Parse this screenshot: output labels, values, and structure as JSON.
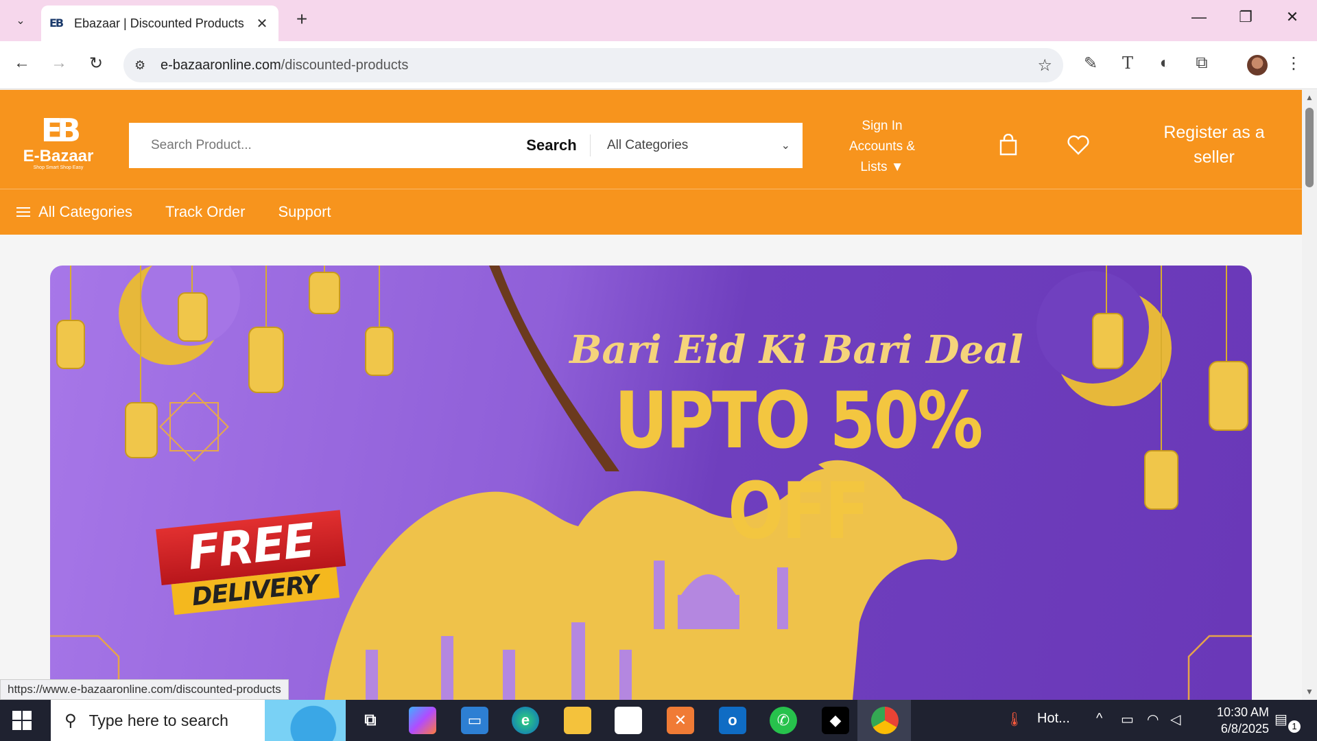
{
  "browser": {
    "tab_title": "Ebazaar | Discounted Products",
    "tab_favicon": "EB",
    "url_host": "e-bazaaronline.com",
    "url_path": "/discounted-products",
    "status_url": "https://www.e-bazaaronline.com/discounted-products"
  },
  "header": {
    "logo_mark": "EB",
    "logo_name": "E-Bazaar",
    "logo_tagline": "Shop Smart Shop Easy",
    "search_placeholder": "Search Product...",
    "search_button": "Search",
    "category_select": "All Categories",
    "signin_line1": "Sign In",
    "signin_line2": "Accounts &",
    "signin_line3": "Lists ▼",
    "register_line1": "Register as a",
    "register_line2": "seller"
  },
  "nav": {
    "all_categories": "All Categories",
    "track_order": "Track Order",
    "support": "Support"
  },
  "banner": {
    "title": "Bari Eid Ki Bari Deal",
    "headline": "UPTO 50% OFF",
    "badge_top": "FREE",
    "badge_bottom": "DELIVERY"
  },
  "taskbar": {
    "search_text": "Type here to search",
    "weather": "Hot...",
    "time": "10:30 AM",
    "date": "6/8/2025",
    "notifications": "1"
  },
  "colors": {
    "brand_orange": "#f7941d",
    "banner_purple": "#7a48c8",
    "gold": "#f3c640"
  }
}
